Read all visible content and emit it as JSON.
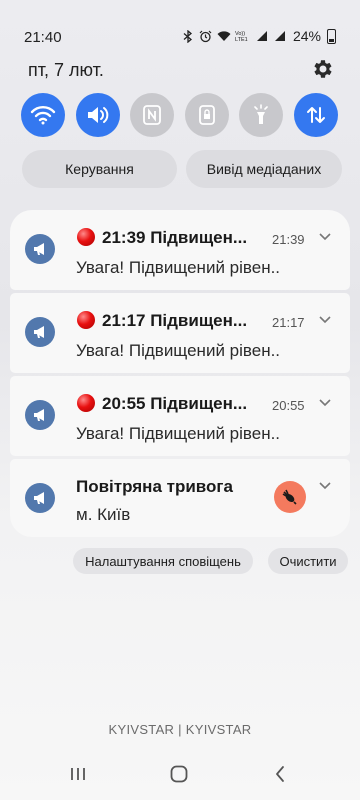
{
  "status_bar": {
    "time": "21:40",
    "battery": "24%",
    "icons": [
      "bluetooth-icon",
      "alarm-icon",
      "wifi-icon",
      "volte-icon",
      "signal-icon",
      "signal-icon",
      "battery-icon"
    ],
    "volte_label": "Vo))\nLTE1"
  },
  "header": {
    "date": "пт, 7 лют."
  },
  "quick_settings": [
    {
      "name": "wifi",
      "icon": "wifi-icon",
      "active": true
    },
    {
      "name": "sound",
      "icon": "volume-icon",
      "active": true
    },
    {
      "name": "nfc",
      "icon": "nfc-icon",
      "active": false
    },
    {
      "name": "rotation-lock",
      "icon": "lock-icon",
      "active": false
    },
    {
      "name": "flashlight",
      "icon": "flashlight-icon",
      "active": false
    },
    {
      "name": "mobile-data",
      "icon": "data-transfer-icon",
      "active": true
    }
  ],
  "pills": {
    "controls": "Керування",
    "media_output": "Вивід медіаданих"
  },
  "notifications": [
    {
      "title": "21:39 Підвищен...",
      "time": "21:39",
      "body": "Увага! Підвищений рівен..",
      "has_red_dot": true
    },
    {
      "title": "21:17 Підвищен...",
      "time": "21:17",
      "body": "Увага! Підвищений рівен..",
      "has_red_dot": true
    },
    {
      "title": "20:55 Підвищен...",
      "time": "20:55",
      "body": "Увага! Підвищений рівен..",
      "has_red_dot": true
    },
    {
      "title": "Повітряна тривога",
      "time": "",
      "body": "м. Київ",
      "has_red_dot": false
    }
  ],
  "actions": {
    "notification_settings": "Налаштування сповіщень",
    "clear": "Очистити"
  },
  "carrier": "KYIVSTAR | KYIVSTAR",
  "colors": {
    "accent": "#3478f0",
    "app_icon": "#5278ad",
    "bomb_avatar": "#f47a5e",
    "red_dot": "#e81010"
  }
}
